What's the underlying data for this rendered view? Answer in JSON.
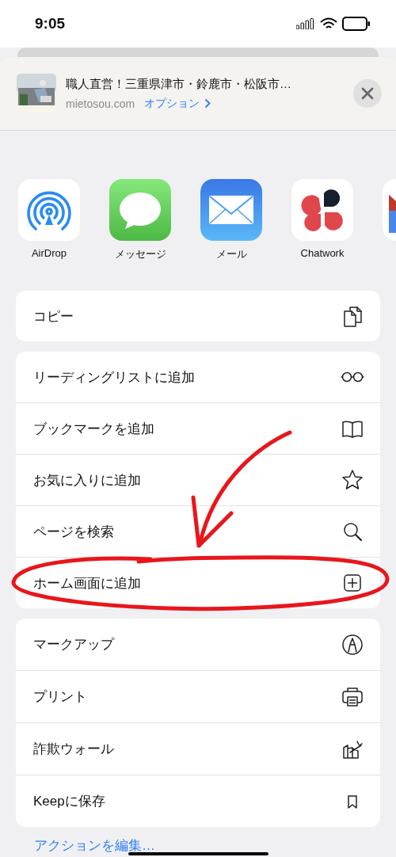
{
  "status_bar": {
    "time": "9:05"
  },
  "share_header": {
    "title": "職人直営！三重県津市・鈴鹿市・松阪市…",
    "domain": "mietosou.com",
    "options_link": "オプション"
  },
  "apps": [
    {
      "kind": "airdrop",
      "label": "AirDrop"
    },
    {
      "kind": "messages",
      "label": "メッセージ"
    },
    {
      "kind": "mail",
      "label": "メール"
    },
    {
      "kind": "chatwork",
      "label": "Chatwork"
    }
  ],
  "action_groups": [
    {
      "items": [
        {
          "kind": "copy",
          "label": "コピー"
        }
      ]
    },
    {
      "items": [
        {
          "kind": "glasses",
          "label": "リーディングリストに追加"
        },
        {
          "kind": "book",
          "label": "ブックマークを追加"
        },
        {
          "kind": "star",
          "label": "お気に入りに追加"
        },
        {
          "kind": "search",
          "label": "ページを検索"
        },
        {
          "kind": "add",
          "label": "ホーム画面に追加"
        }
      ]
    },
    {
      "items": [
        {
          "kind": "markup",
          "label": "マークアップ"
        },
        {
          "kind": "print",
          "label": "プリント"
        },
        {
          "kind": "fraud",
          "label": "詐欺ウォール"
        },
        {
          "kind": "bookmark",
          "label": "Keepに保存"
        }
      ]
    }
  ],
  "edit_actions_link": "アクションを編集…"
}
